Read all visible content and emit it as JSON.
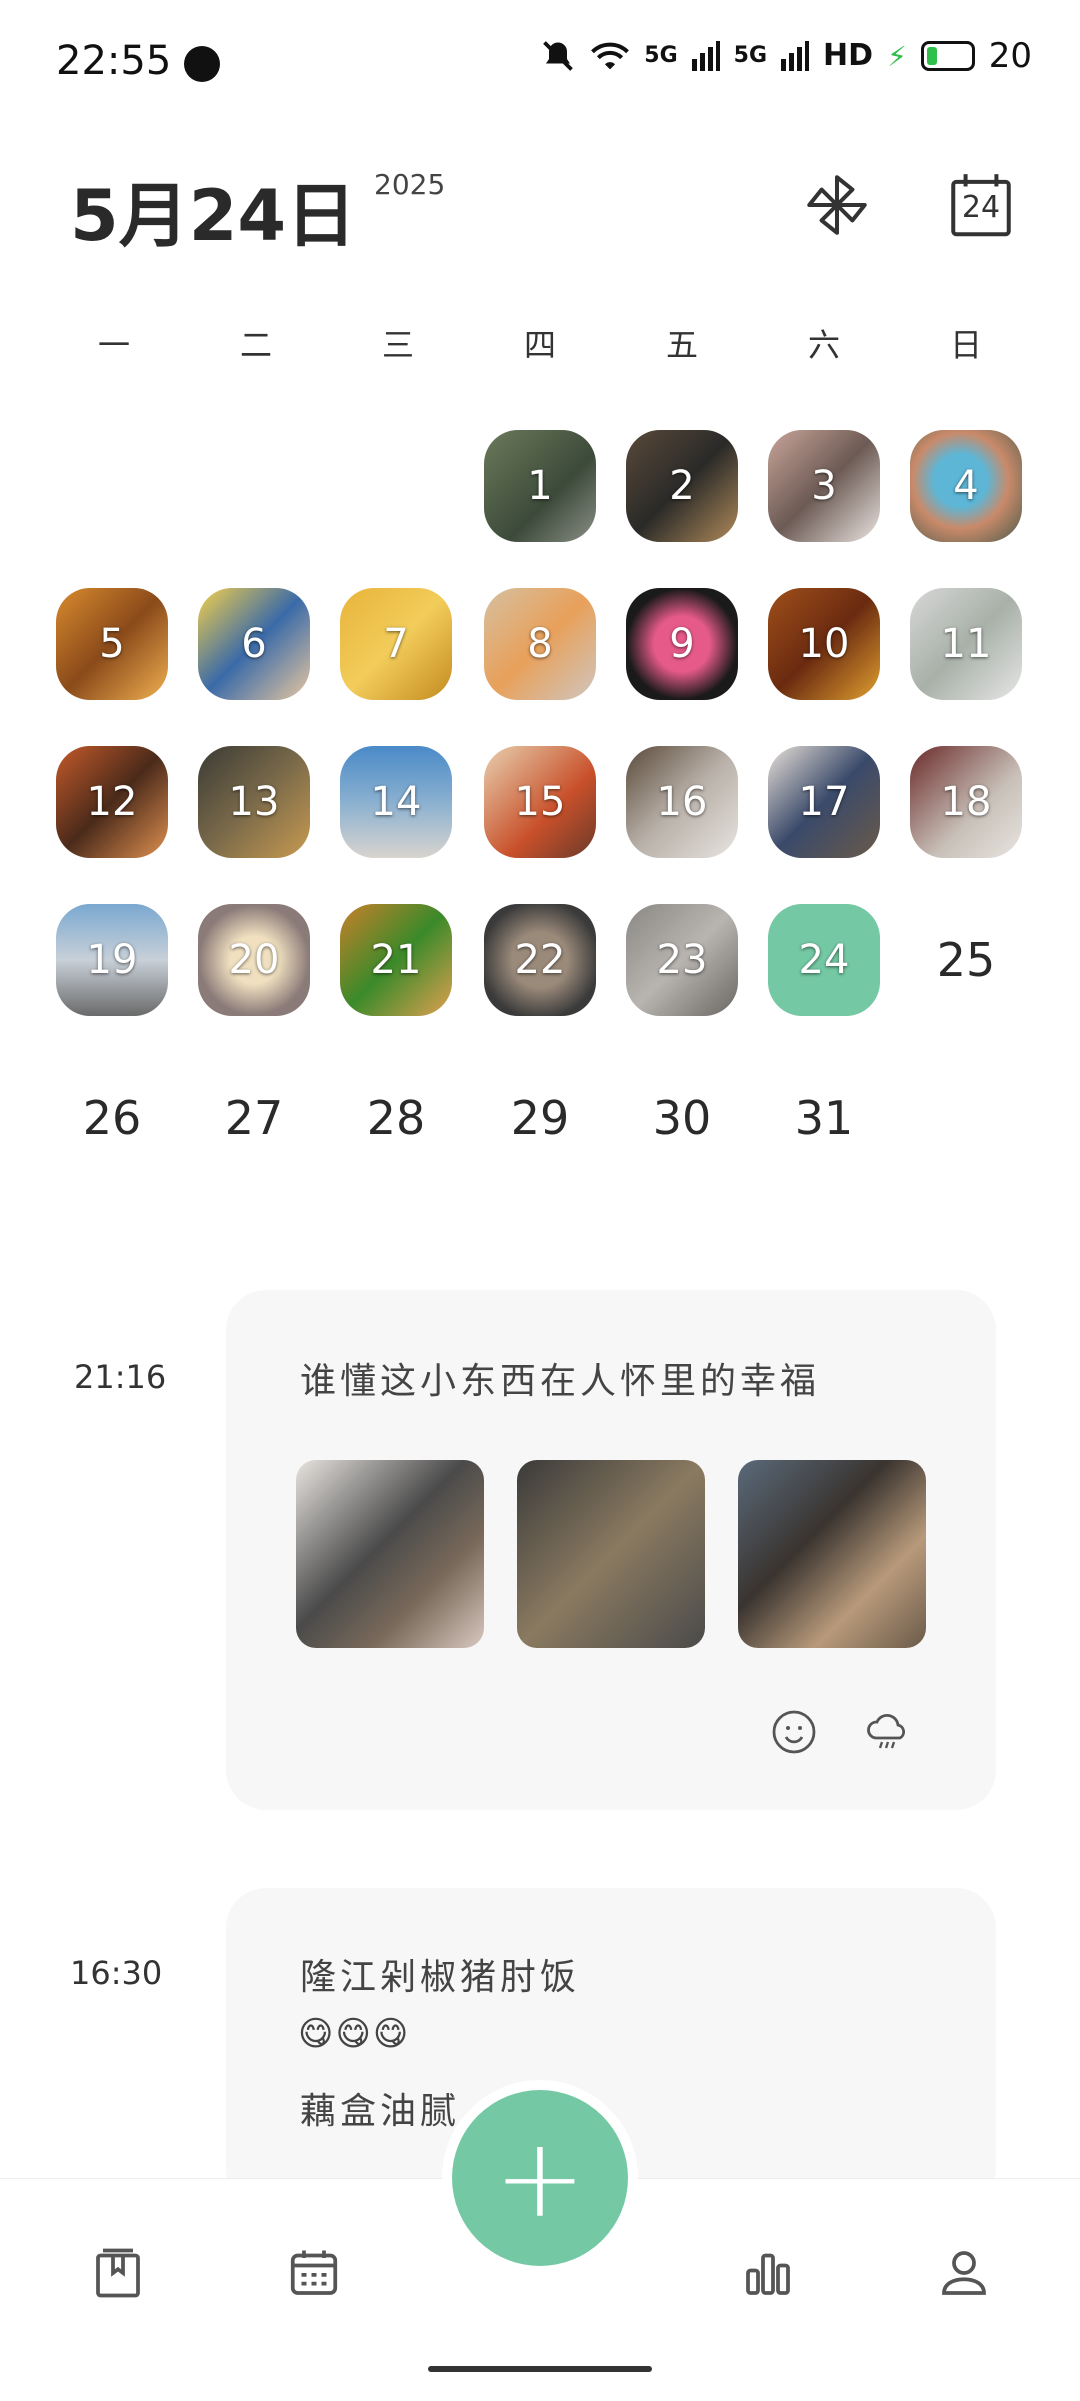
{
  "status_bar": {
    "time": "22:55",
    "network_5g_1": "5G",
    "network_5g_2": "5G",
    "hd": "HD",
    "battery": "20"
  },
  "header": {
    "date_title": "5月24日",
    "year": "2025",
    "calendar_icon_day": "24"
  },
  "weekdays": [
    "一",
    "二",
    "三",
    "四",
    "五",
    "六",
    "日"
  ],
  "calendar": {
    "days": [
      "1",
      "2",
      "3",
      "4",
      "5",
      "6",
      "7",
      "8",
      "9",
      "10",
      "11",
      "12",
      "13",
      "14",
      "15",
      "16",
      "17",
      "18",
      "19",
      "20",
      "21",
      "22",
      "23",
      "24",
      "25",
      "26",
      "27",
      "28",
      "29",
      "30",
      "31"
    ]
  },
  "entries": [
    {
      "time": "21:16",
      "text": "谁懂这小东西在人怀里的幸福"
    },
    {
      "time": "16:30",
      "line1": "隆江剁椒猪肘饭",
      "line2": "😋😋😋",
      "line3": "藕盒油腻"
    }
  ],
  "fab_label": "+",
  "colors": {
    "accent": "#74c9a4",
    "card_bg": "#f7f7f7"
  },
  "icons": [
    "pinwheel-icon",
    "calendar-icon",
    "smile-icon",
    "weather-icon",
    "diary-icon",
    "calendar-tab-icon",
    "stats-icon",
    "profile-icon"
  ]
}
